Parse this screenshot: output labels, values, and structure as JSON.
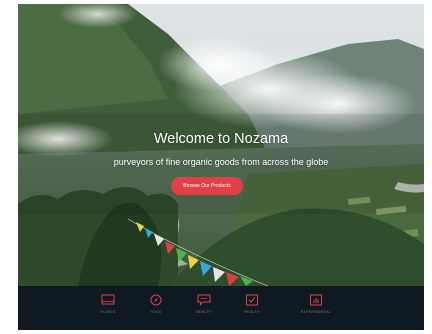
{
  "hero": {
    "title": "Welcome to Nozama",
    "subtitle": "purveyors of fine organic goods from across the globe",
    "cta_label": "Browse Our Products"
  },
  "nav": {
    "items": [
      {
        "label": "PLANTS",
        "icon": "monitor-icon"
      },
      {
        "label": "FOOD",
        "icon": "compass-icon"
      },
      {
        "label": "BEAUTY",
        "icon": "message-icon"
      },
      {
        "label": "HEALTH",
        "icon": "checkbox-icon"
      },
      {
        "label": "EXPERIMENTAL",
        "icon": "bar-chart-icon"
      }
    ]
  },
  "colors": {
    "accent": "#e14048",
    "icon": "#e0404a",
    "nav_bg": "#0e1922"
  }
}
